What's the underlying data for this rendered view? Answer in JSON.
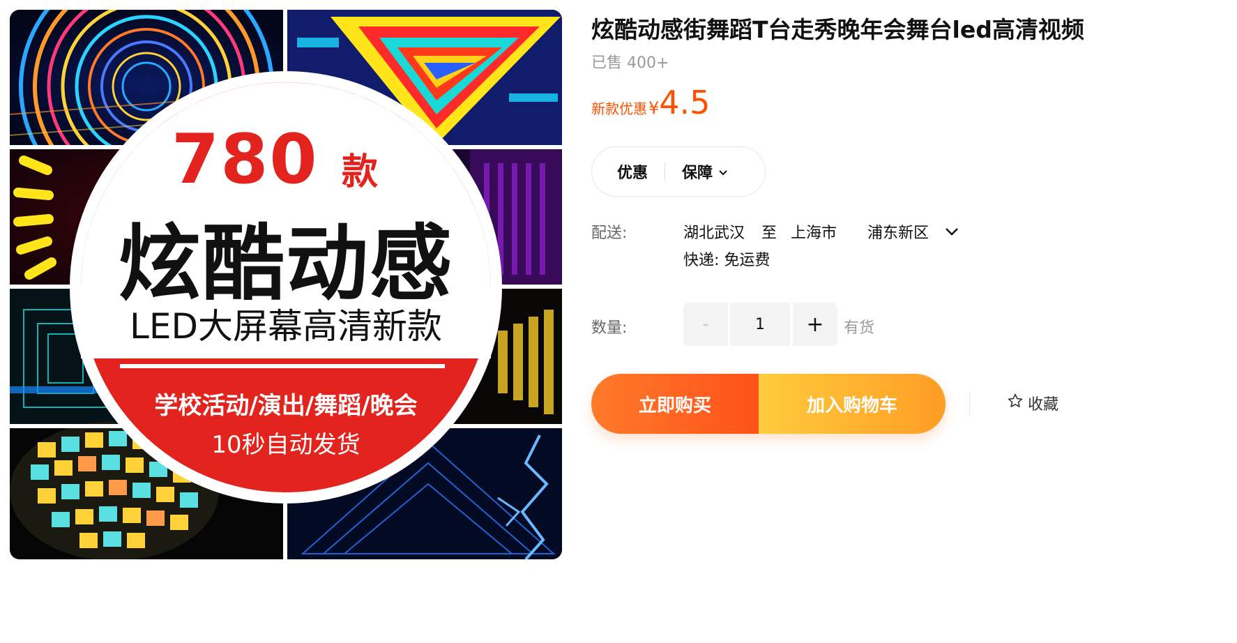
{
  "product_image": {
    "count_number": "780",
    "count_unit": "款",
    "headline": "炫酷动感",
    "subheadline": "LED大屏幕高清新款",
    "activities": "学校活动/演出/舞蹈/晚会",
    "delivery_note": "10秒自动发货"
  },
  "product": {
    "title": "炫酷动感街舞蹈T台走秀晚年会舞台led高清视频",
    "sold": "已售 400+",
    "price_label": "新款优惠",
    "currency": "¥",
    "price": "4.5"
  },
  "tags": {
    "promo": "优惠",
    "guarantee": "保障"
  },
  "shipping": {
    "label": "配送:",
    "origin": "湖北武汉",
    "to": "至",
    "city": "上海市",
    "district": "浦东新区",
    "method": "快递: 免运费"
  },
  "quantity": {
    "label": "数量:",
    "minus": "-",
    "value": "1",
    "plus": "+",
    "stock": "有货"
  },
  "actions": {
    "buy_now": "立即购买",
    "add_cart": "加入购物车",
    "favorite": "收藏"
  },
  "colors": {
    "accent": "#ff5000",
    "buy_now": "#ff5f1f",
    "add_cart": "#ffb52e",
    "banner_red": "#e3231d"
  },
  "icons": [
    "chevron-down-icon",
    "star-outline-icon"
  ]
}
